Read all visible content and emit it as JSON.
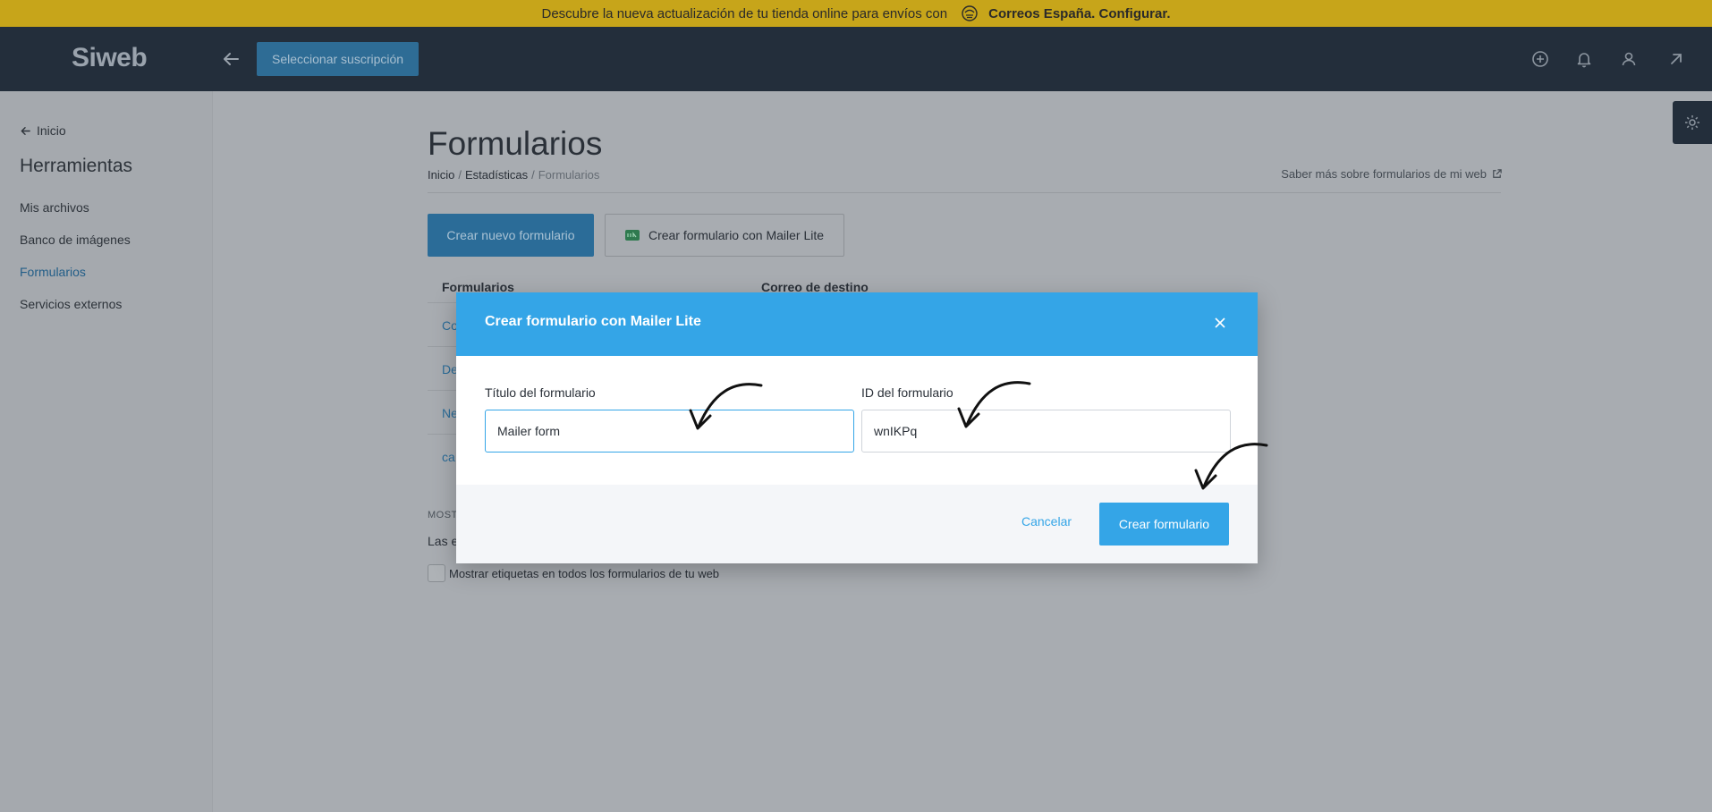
{
  "banner": {
    "text": "Descubre la nueva actualización de tu tienda online para envíos con",
    "link": "Correos España. Configurar.",
    "icon": "correos-logo-icon"
  },
  "header": {
    "brand": "Siweb",
    "subscription_button": "Seleccionar suscripción",
    "icons": [
      "back-arrow-icon",
      "plus-circle-icon",
      "bell-icon",
      "user-icon",
      "external-arrow-icon"
    ]
  },
  "sidebar": {
    "back_label": "Inicio",
    "title": "Herramientas",
    "items": [
      {
        "label": "Mis archivos",
        "active": false
      },
      {
        "label": "Banco de imágenes",
        "active": false
      },
      {
        "label": "Formularios",
        "active": true
      },
      {
        "label": "Servicios externos",
        "active": false
      }
    ]
  },
  "main": {
    "title": "Formularios",
    "breadcrumb": [
      "Inicio",
      "Estadísticas",
      "Formularios"
    ],
    "learn_more": "Saber más sobre formularios de mi web",
    "btn_new": "Crear nuevo formulario",
    "btn_mailer": "Crear formulario con Mailer Lite",
    "table": {
      "columns": [
        "Formularios",
        "Correo de destino"
      ],
      "rows": [
        "Co",
        "De",
        "Ne",
        "ca"
      ]
    },
    "mostrar_label": "MOST",
    "las_text": "Las e",
    "checkbox_label": "Mostrar etiquetas en todos los formularios de tu web"
  },
  "modal": {
    "title": "Crear formulario con Mailer Lite",
    "title_field_label": "Título del formulario",
    "title_field_value": "Mailer form",
    "id_field_label": "ID del formulario",
    "id_field_value": "wnIKPq",
    "cancel": "Cancelar",
    "submit": "Crear formulario"
  },
  "colors": {
    "banner": "#c7a51a",
    "header": "#232e3b",
    "modal_accent": "#34a5e7",
    "overlay_bg": "#a8acb1"
  }
}
